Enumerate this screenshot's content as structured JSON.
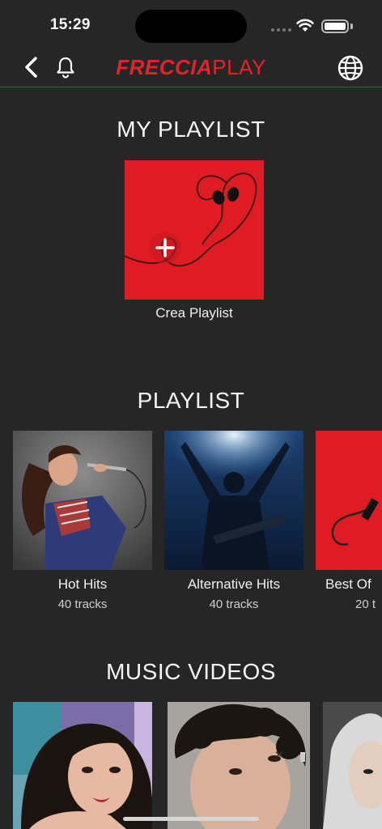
{
  "status_bar": {
    "time": "15:29"
  },
  "header": {
    "logo_part1": "FRECCIA",
    "logo_part2": "PLAY"
  },
  "my_playlist": {
    "title": "MY PLAYLIST",
    "create_label": "Crea Playlist"
  },
  "playlist": {
    "title": "PLAYLIST",
    "items": [
      {
        "title": "Hot Hits",
        "subtitle": "40 tracks"
      },
      {
        "title": "Alternative Hits",
        "subtitle": "40 tracks"
      },
      {
        "title": "Best Of",
        "subtitle": "20 t"
      }
    ]
  },
  "music_videos": {
    "title": "MUSIC VIDEOS"
  },
  "colors": {
    "accent": "#e3232b",
    "background": "#262626"
  }
}
